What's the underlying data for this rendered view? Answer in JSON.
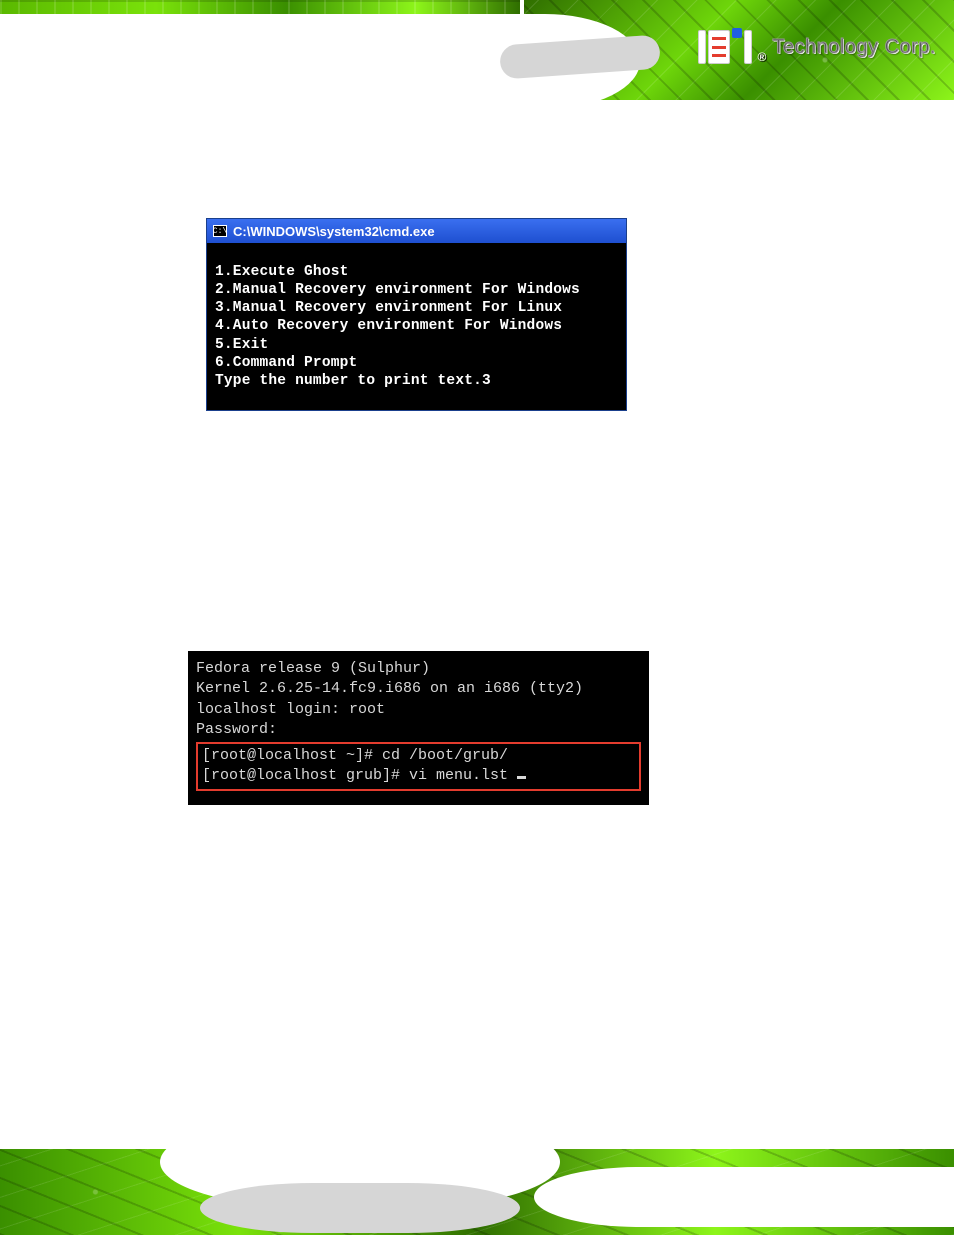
{
  "brand": {
    "name": "iEi",
    "registered": "®",
    "tagline": "Technology Corp."
  },
  "cmd": {
    "icon": "C:\\",
    "title": "C:\\WINDOWS\\system32\\cmd.exe",
    "lines": [
      "1.Execute Ghost",
      "2.Manual Recovery environment For Windows",
      "3.Manual Recovery environment For Linux",
      "4.Auto Recovery environment For Windows",
      "5.Exit",
      "6.Command Prompt",
      "Type the number to print text.3"
    ]
  },
  "linux": {
    "plain_lines": [
      "Fedora release 9 (Sulphur)",
      "Kernel 2.6.25-14.fc9.i686 on an i686 (tty2)",
      "",
      "localhost login: root",
      "Password:"
    ],
    "hl_lines": [
      "[root@localhost ~]# cd /boot/grub/",
      "[root@localhost grub]# vi menu.lst "
    ]
  }
}
